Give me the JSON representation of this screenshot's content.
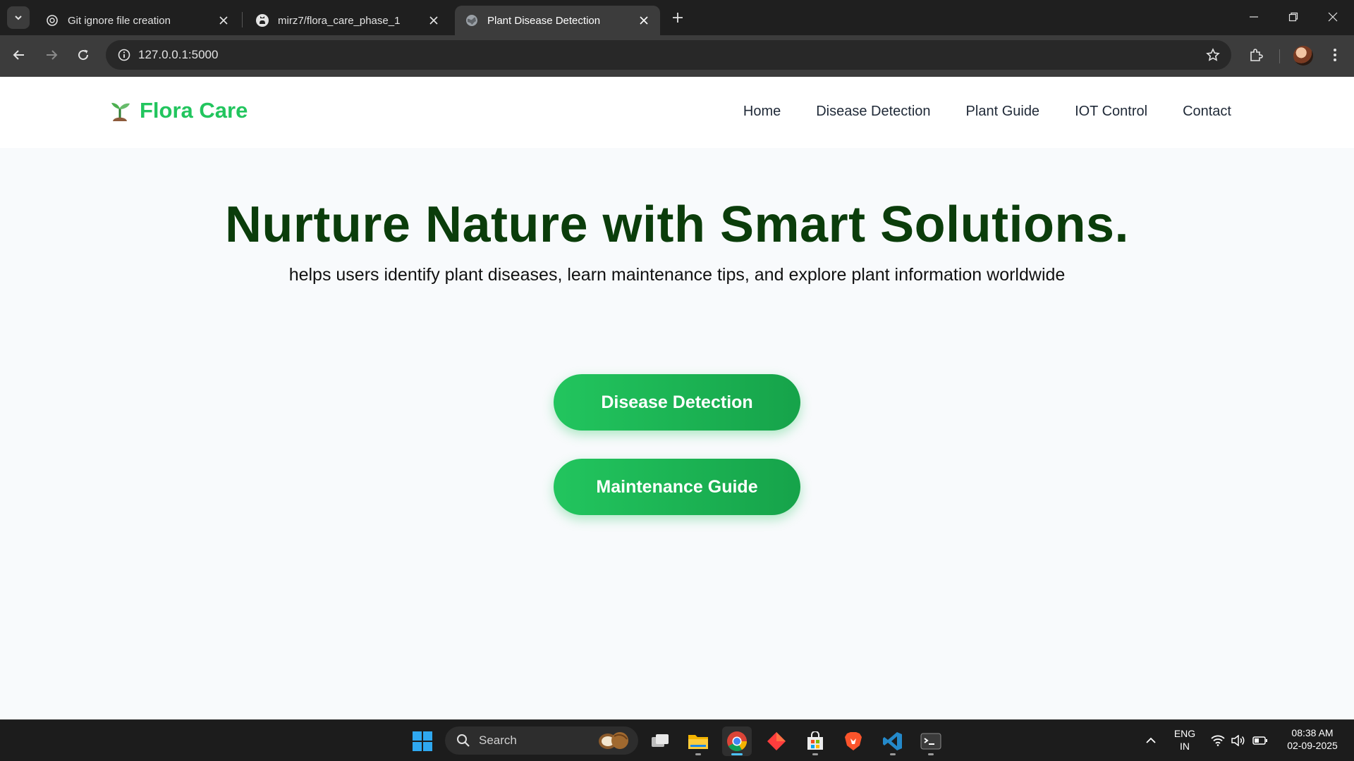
{
  "browser": {
    "tabs": [
      {
        "title": "Git ignore file creation",
        "icon": "chatgpt-icon"
      },
      {
        "title": "mirz7/flora_care_phase_1",
        "icon": "github-icon"
      },
      {
        "title": "Plant Disease Detection",
        "icon": "globe-icon",
        "active": true
      }
    ],
    "url": "127.0.0.1:5000"
  },
  "site": {
    "brand": "Flora Care",
    "brand_icon": "seedling-icon",
    "nav": [
      "Home",
      "Disease Detection",
      "Plant Guide",
      "IOT Control",
      "Contact"
    ]
  },
  "hero": {
    "title": "Nurture Nature with Smart Solutions.",
    "subtitle": "helps users identify plant diseases, learn maintenance tips, and explore plant information worldwide",
    "buttons": [
      "Disease Detection",
      "Maintenance Guide"
    ]
  },
  "taskbar": {
    "search_label": "Search",
    "language": "ENG",
    "region": "IN",
    "time": "08:38 AM",
    "date": "02-09-2025"
  },
  "colors": {
    "brand_green": "#22c55e",
    "headline_green": "#0b3d0b",
    "button_gradient_end": "#16a34a"
  }
}
